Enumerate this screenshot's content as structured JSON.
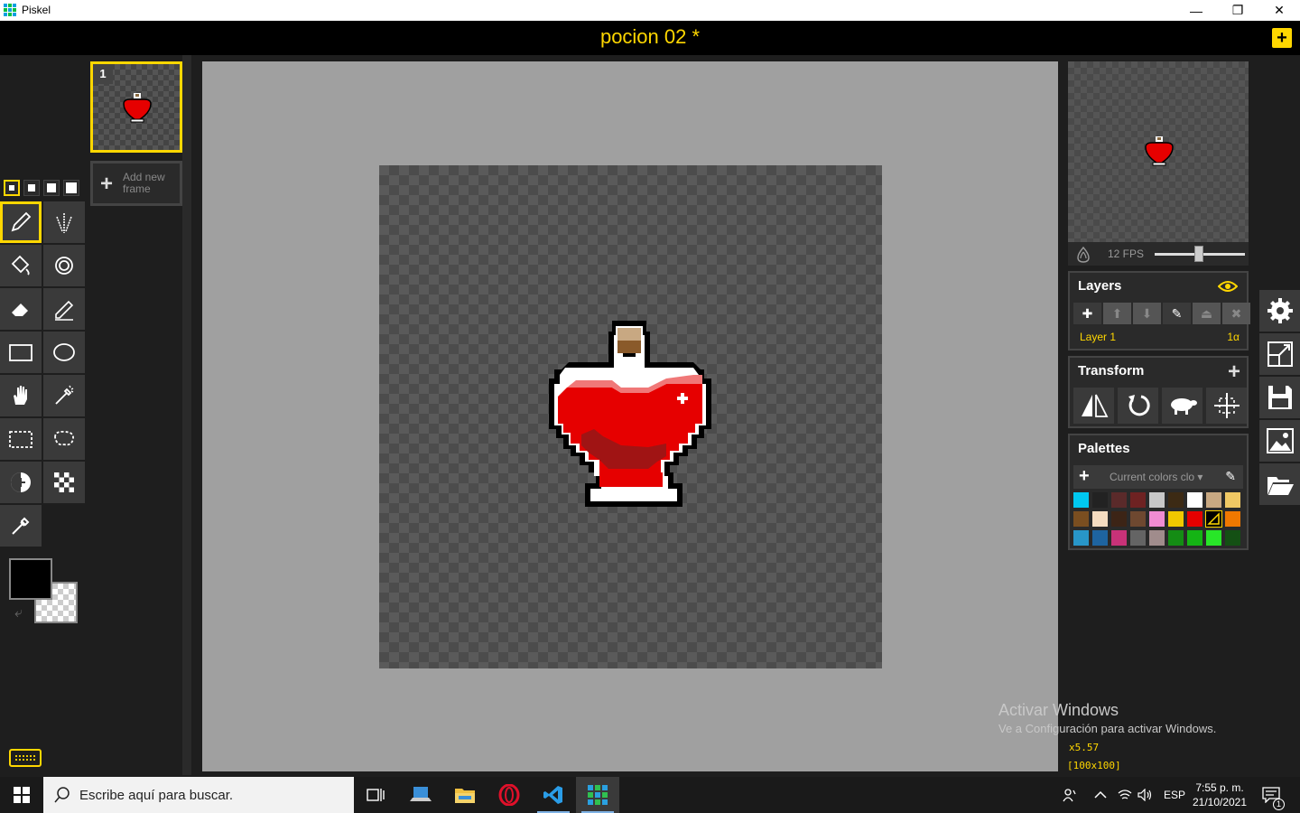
{
  "window": {
    "title": "Piskel",
    "minimize": "—",
    "maximize": "❐",
    "close": "✕"
  },
  "header": {
    "doc_title": "pocion 02 *",
    "new_label": "+"
  },
  "tools": {
    "pen_sizes": [
      1,
      2,
      3,
      4
    ],
    "items": [
      {
        "name": "pen-tool-icon",
        "active": true
      },
      {
        "name": "vertical-mirror-pen-icon",
        "active": false
      },
      {
        "name": "paint-bucket-icon",
        "active": false
      },
      {
        "name": "paint-all-same-color-icon",
        "active": false
      },
      {
        "name": "eraser-icon",
        "active": false
      },
      {
        "name": "stroke-tool-icon",
        "active": false
      },
      {
        "name": "rectangle-tool-icon",
        "active": false
      },
      {
        "name": "circle-tool-icon",
        "active": false
      },
      {
        "name": "move-hand-icon",
        "active": false
      },
      {
        "name": "shape-selection-icon",
        "active": false
      },
      {
        "name": "rectangle-selection-icon",
        "active": false
      },
      {
        "name": "lasso-selection-icon",
        "active": false
      },
      {
        "name": "lighten-tool-icon",
        "active": false
      },
      {
        "name": "dithering-tool-icon",
        "active": false
      },
      {
        "name": "color-picker-icon",
        "active": false
      }
    ],
    "primary_color": "#000000",
    "secondary_color": "transparent"
  },
  "frames": {
    "items": [
      {
        "number": "1"
      }
    ],
    "add_label": "Add new frame"
  },
  "preview": {
    "fps_label": "12 FPS",
    "fps": 12
  },
  "layers": {
    "title": "Layers",
    "items": [
      {
        "name": "Layer 1",
        "alpha": "1α"
      }
    ]
  },
  "transform": {
    "title": "Transform",
    "add": "+"
  },
  "palettes": {
    "title": "Palettes",
    "add": "+",
    "selected": "Current colors clo",
    "colors": [
      "#00c8f0",
      "#222222",
      "#5a2a2a",
      "#6e2222",
      "#c8c8c8",
      "#3c2a14",
      "#ffffff",
      "#c8a882",
      "#f0c864",
      "#7a4e20",
      "#f5dcc0",
      "#3c2416",
      "#6e4830",
      "#f08cd2",
      "#f0c800",
      "#e60000",
      "#000000",
      "#f07800",
      "#2896c8",
      "#1e64a0",
      "#c83278",
      "#646464",
      "#a08c8c",
      "#148c14",
      "#14b414",
      "#28e628",
      "#145014"
    ]
  },
  "watermark": {
    "line1": "Activar Windows",
    "line2": "Ve a Configuración para activar Windows."
  },
  "status": {
    "zoom": "x5.57",
    "size": "[100x100]"
  },
  "taskbar": {
    "search_placeholder": "Escribe aquí para buscar.",
    "lang": "ESP",
    "time": "7:55 p. m.",
    "date": "21/10/2021",
    "notif_count": "1"
  }
}
